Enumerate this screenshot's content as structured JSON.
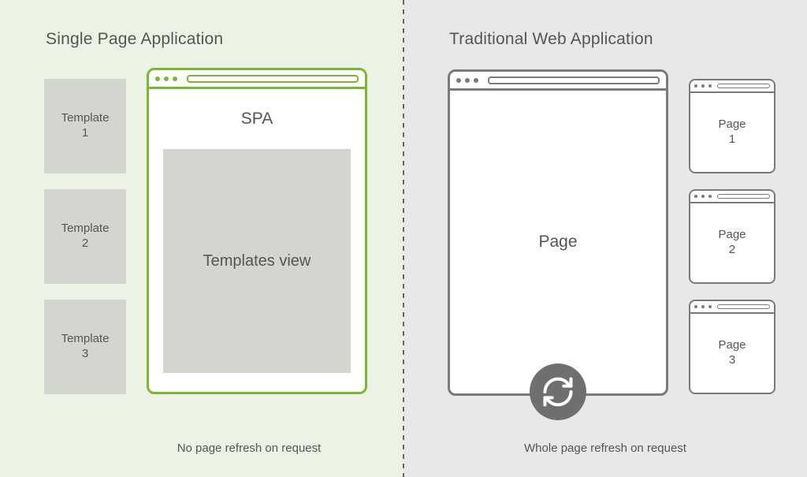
{
  "left": {
    "title": "Single Page Application",
    "caption": "No page refresh on request",
    "templates": [
      "Template\n1",
      "Template\n2",
      "Template\n3"
    ],
    "spa_label": "SPA",
    "templates_view_label": "Templates view"
  },
  "right": {
    "title": "Traditional Web Application",
    "caption": "Whole page refresh on request",
    "page_label": "Page",
    "pages": [
      "Page\n1",
      "Page\n2",
      "Page\n3"
    ]
  },
  "colors": {
    "accent_green": "#7cb636",
    "panel_left_bg": "#edf3e4",
    "panel_right_bg": "#e8e8e8",
    "gray_stroke": "#7a7a7a",
    "fill_block": "#d3d6cf"
  }
}
